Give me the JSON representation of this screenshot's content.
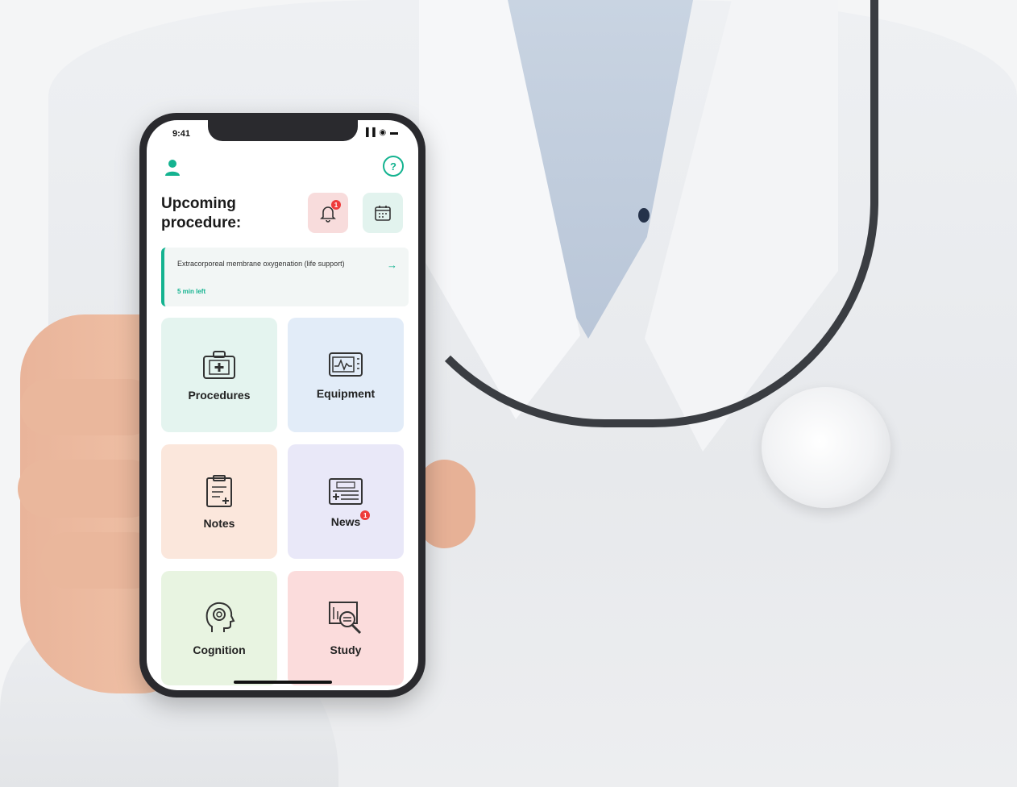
{
  "status_bar": {
    "time": "9:41",
    "indicators": "▐▐ ◉ ▬"
  },
  "header": {
    "profile_icon": "profile-icon",
    "help_icon": "help-icon",
    "help_symbol": "?"
  },
  "title": {
    "line1": "Upcoming",
    "line2": "procedure:"
  },
  "actions": {
    "notifications": {
      "icon": "bell-icon",
      "badge": "1",
      "color": "#f8dcdc"
    },
    "calendar": {
      "icon": "calendar-icon",
      "color": "#e2f3ee"
    }
  },
  "upcoming": {
    "name": "Extracorporeal membrane oxygenation (life support)",
    "time_left": "5 min left",
    "arrow": "→"
  },
  "tiles": [
    {
      "label": "Procedures",
      "icon": "medical-kit-icon",
      "color": "#e4f4ef"
    },
    {
      "label": "Equipment",
      "icon": "monitor-icon",
      "color": "#e2ecf8"
    },
    {
      "label": "Notes",
      "icon": "clipboard-icon",
      "color": "#fbe7dc"
    },
    {
      "label": "News",
      "icon": "newspaper-icon",
      "color": "#e9e8f8",
      "badge": "1"
    },
    {
      "label": "Cognition",
      "icon": "brain-head-icon",
      "color": "#e8f4e1"
    },
    {
      "label": "Study",
      "icon": "study-search-icon",
      "color": "#fbdcdc"
    }
  ],
  "accent_color": "#14b390"
}
